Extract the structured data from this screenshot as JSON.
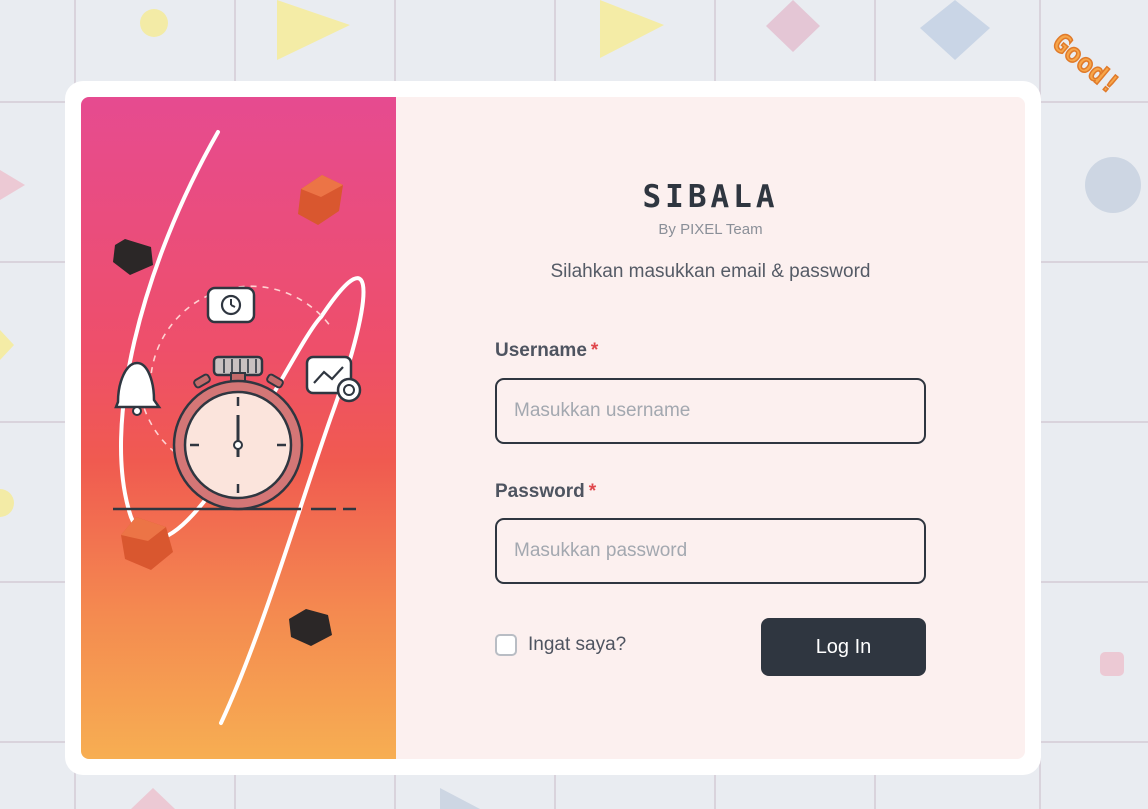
{
  "app": {
    "brand": "SIBALA",
    "byline": "By PIXEL Team",
    "subtitle": "Silahkan masukkan email & password"
  },
  "form": {
    "username_label": "Username",
    "username_placeholder": "Masukkan username",
    "password_label": "Password",
    "password_placeholder": "Masukkan password",
    "required_mark": "*",
    "remember_label": "Ingat saya?",
    "remember_checked": false,
    "submit_label": "Log In"
  },
  "decoration": {
    "sticker_text": "Good!"
  },
  "colors": {
    "accent_dark": "#2f3640",
    "required": "#e0474c",
    "panel_bg": "#fcf0ef",
    "hero_gradient_top": "#e64b90",
    "hero_gradient_bottom": "#f7ae52"
  }
}
